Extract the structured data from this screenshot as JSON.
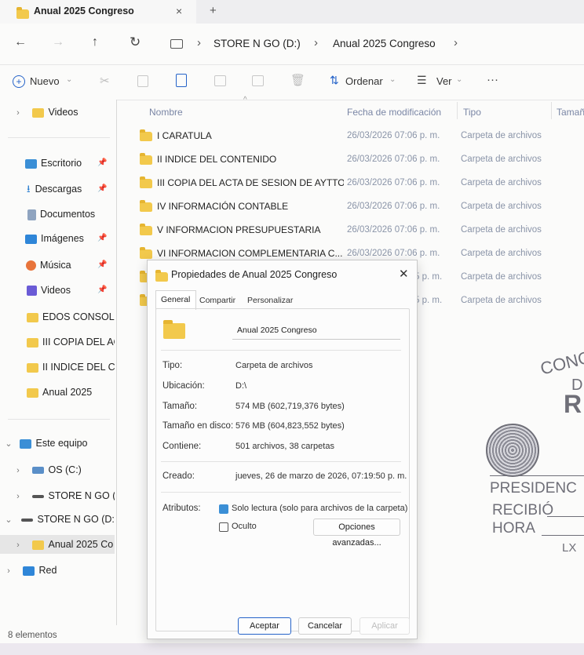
{
  "window": {
    "tab_title": "Anual 2025 Congreso",
    "tab_close": "×",
    "tab_add": "+"
  },
  "nav": {
    "back": "←",
    "forward": "→",
    "up": "↑",
    "refresh": "↻",
    "breadcrumb": [
      "STORE N GO (D:)",
      "Anual 2025 Congreso"
    ],
    "sep": "›"
  },
  "toolbar": {
    "new_label": "Nuevo",
    "sort_label": "Ordenar",
    "view_label": "Ver",
    "more_label": "···"
  },
  "sidebar": {
    "items": [
      {
        "label": "Videos",
        "icon": "folder-icon",
        "color": "#f2c94c"
      },
      {
        "label": "Escritorio",
        "icon": "desktop-icon",
        "color": "#3b8fd6"
      },
      {
        "label": "Descargas",
        "icon": "download-icon",
        "color": "#2a7ed0"
      },
      {
        "label": "Documentos",
        "icon": "documents-icon",
        "color": "#8fa4c0"
      },
      {
        "label": "Imágenes",
        "icon": "pictures-icon",
        "color": "#2f86d8"
      },
      {
        "label": "Música",
        "icon": "music-icon",
        "color": "#e8743b"
      },
      {
        "label": "Videos",
        "icon": "videos-icon",
        "color": "#6a5bd6"
      },
      {
        "label": "EDOS CONSOLII",
        "icon": "folder-icon",
        "color": "#f2c94c"
      },
      {
        "label": "III COPIA DEL AC",
        "icon": "folder-icon",
        "color": "#f2c94c"
      },
      {
        "label": "II INDICE DEL CC",
        "icon": "folder-icon",
        "color": "#f2c94c"
      },
      {
        "label": "Anual 2025",
        "icon": "folder-icon",
        "color": "#f2c94c"
      },
      {
        "label": "Este equipo",
        "icon": "computer-icon",
        "color": "#3b8fd6"
      },
      {
        "label": "OS (C:)",
        "icon": "drive-icon",
        "color": "#5a8fc8"
      },
      {
        "label": "STORE N GO (I",
        "icon": "usb-drive-icon",
        "color": "#555555"
      },
      {
        "label": "STORE N GO (D:",
        "icon": "usb-drive-icon",
        "color": "#555555"
      },
      {
        "label": "Anual 2025 Co",
        "icon": "folder-icon",
        "color": "#f2c94c"
      },
      {
        "label": "Red",
        "icon": "network-icon",
        "color": "#2f86d8"
      }
    ]
  },
  "columns": {
    "name": "Nombre",
    "modified": "Fecha de modificación",
    "type": "Tipo",
    "size": "Tamaño"
  },
  "files": [
    {
      "name": "I CARATULA",
      "modified": "26/03/2026 07:06 p. m.",
      "type": "Carpeta de archivos"
    },
    {
      "name": "II INDICE DEL CONTENIDO",
      "modified": "26/03/2026 07:06 p. m.",
      "type": "Carpeta de archivos"
    },
    {
      "name": "III COPIA DEL ACTA DE SESION DE AYTTO",
      "modified": "26/03/2026 07:06 p. m.",
      "type": "Carpeta de archivos"
    },
    {
      "name": "IV INFORMACIÓN CONTABLE",
      "modified": "26/03/2026 07:06 p. m.",
      "type": "Carpeta de archivos"
    },
    {
      "name": "V  INFORMACION PRESUPUESTARIA",
      "modified": "26/03/2026 07:06 p. m.",
      "type": "Carpeta de archivos"
    },
    {
      "name": "VI  INFORMACION COMPLEMENTARIA C...",
      "modified": "26/03/2026 07:06 p. m.",
      "type": "Carpeta de archivos"
    },
    {
      "name": "",
      "modified": "5 p. m.",
      "type": "Carpeta de archivos"
    },
    {
      "name": "",
      "modified": "5 p. m.",
      "type": "Carpeta de archivos"
    }
  ],
  "status": {
    "count": "8 elementos"
  },
  "dialog": {
    "title": "Propiedades de Anual 2025 Congreso",
    "close": "✕",
    "tabs": [
      "General",
      "Compartir",
      "Personalizar"
    ],
    "folder_name": "Anual 2025 Congreso",
    "props": [
      {
        "label": "Tipo:",
        "value": "Carpeta de archivos"
      },
      {
        "label": "Ubicación:",
        "value": "D:\\"
      },
      {
        "label": "Tamaño:",
        "value": "574 MB (602,719,376 bytes)"
      },
      {
        "label": "Tamaño en disco:",
        "value": "576 MB (604,823,552 bytes)"
      },
      {
        "label": "Contiene:",
        "value": "501 archivos, 38 carpetas"
      }
    ],
    "created_label": "Creado:",
    "created_value": "jueves, 26 de marzo de 2026, 07:19:50 p. m.",
    "attributes_label": "Atributos:",
    "readonly_label": "Solo lectura (solo para archivos de la carpeta)",
    "hidden_label": "Oculto",
    "advanced_label": "Opciones avanzadas...",
    "ok_label": "Aceptar",
    "cancel_label": "Cancelar",
    "apply_label": "Aplicar"
  },
  "stamp": {
    "lines": [
      "CONG",
      "D",
      "R",
      "PRESIDENC",
      "RECIBIÓ",
      "HORA",
      "LX"
    ]
  }
}
